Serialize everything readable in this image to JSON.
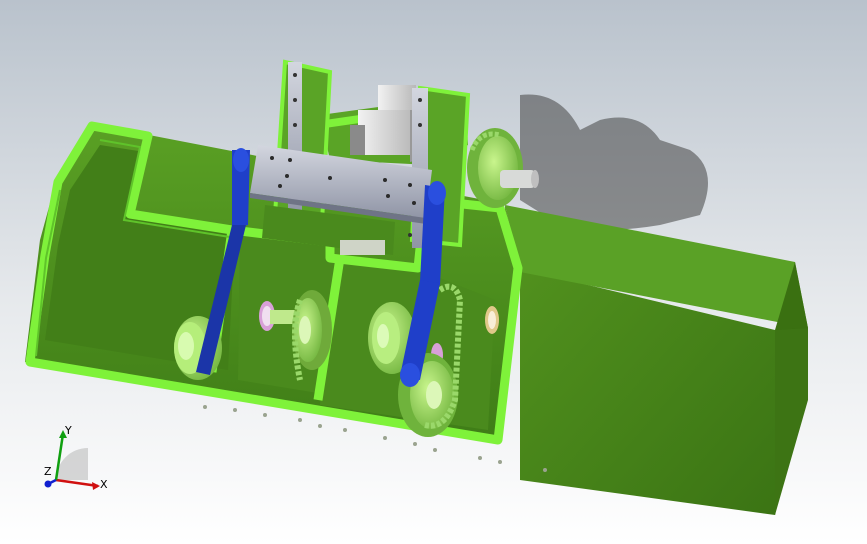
{
  "triad": {
    "x_label": "X",
    "y_label": "Y",
    "z_label": "Z"
  },
  "colors": {
    "body_green": "#4e8f1e",
    "edge_green": "#7ff23a",
    "bracket_blue": "#1f3fc9",
    "rail_gray": "#b8bcc9",
    "chain_green": "#8fd36a",
    "axis_x": "#d01010",
    "axis_y": "#10a010",
    "axis_z": "#1020d0"
  },
  "icons": [
    "view-triad-icon"
  ]
}
